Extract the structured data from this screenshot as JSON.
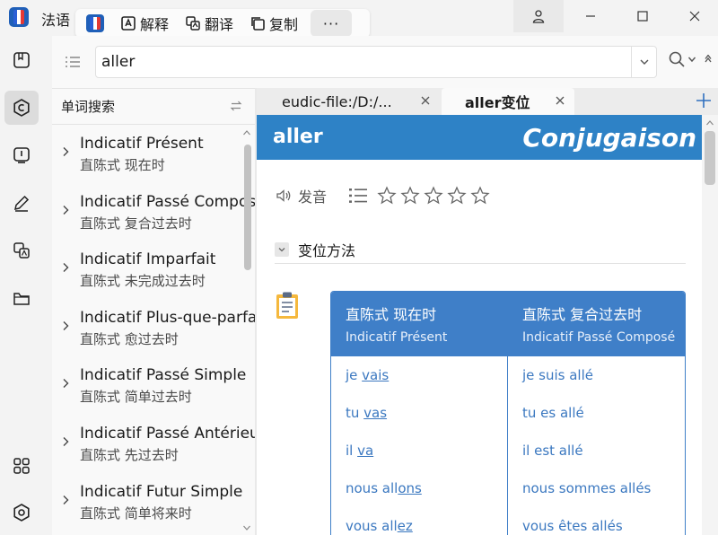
{
  "app": {
    "title": "法语"
  },
  "toolbar": {
    "explain": "解释",
    "translate": "翻译",
    "copy": "复制",
    "more": "···"
  },
  "search": {
    "value": "aller",
    "placeholder": ""
  },
  "wordlist": {
    "header": "单词搜索",
    "items": [
      {
        "title": "Indicatif Présent",
        "sub": "直陈式 现在时"
      },
      {
        "title": "Indicatif Passé Composé",
        "sub": "直陈式 复合过去时"
      },
      {
        "title": "Indicatif Imparfait",
        "sub": "直陈式 未完成过去时"
      },
      {
        "title": "Indicatif Plus-que-parfait",
        "sub": "直陈式 愈过去时"
      },
      {
        "title": "Indicatif Passé Simple",
        "sub": "直陈式 简单过去时"
      },
      {
        "title": "Indicatif Passé Antérieur",
        "sub": "直陈式 先过去时"
      },
      {
        "title": "Indicatif Futur Simple",
        "sub": "直陈式 简单将来时"
      }
    ]
  },
  "tabs": [
    {
      "label": "eudic-file:/D:/..."
    },
    {
      "label": "aller变位"
    }
  ],
  "entry": {
    "word": "aller",
    "brand": "Conjugaison",
    "audio_label": "发音",
    "section_label": "变位方法",
    "columns": [
      {
        "zh": "直陈式 现在时",
        "fr": "Indicatif Présent",
        "rows": [
          {
            "pre": "je ",
            "verb": "vais"
          },
          {
            "pre": "tu ",
            "verb": "vas"
          },
          {
            "pre": "il ",
            "verb": "va"
          },
          {
            "pre": "nous all",
            "verb": "ons"
          },
          {
            "pre": "vous all",
            "verb": "ez"
          }
        ]
      },
      {
        "zh": "直陈式 复合过去时",
        "fr": "Indicatif Passé Composé",
        "rows": [
          {
            "pre": "je suis allé",
            "verb": ""
          },
          {
            "pre": "tu es allé",
            "verb": ""
          },
          {
            "pre": "il est allé",
            "verb": ""
          },
          {
            "pre": "nous sommes allés",
            "verb": ""
          },
          {
            "pre": "vous êtes allés",
            "verb": ""
          }
        ]
      }
    ]
  },
  "colors": {
    "header_blue": "#2e82c6",
    "table_blue": "#3f7fc8",
    "link_blue": "#3b78c0"
  }
}
